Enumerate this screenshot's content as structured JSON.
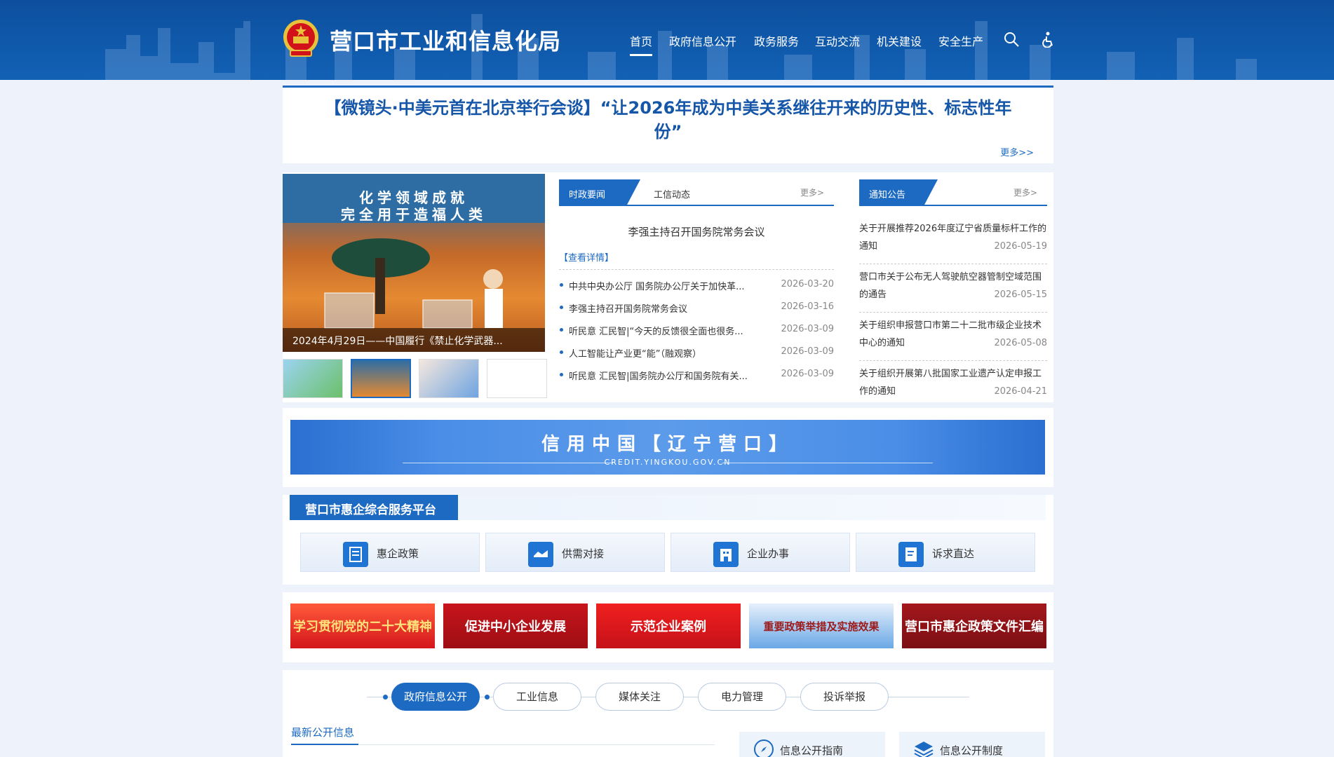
{
  "header": {
    "title": "营口市工业和信息化局",
    "nav": [
      {
        "label": "首页",
        "active": true
      },
      {
        "label": "政府信息公开"
      },
      {
        "label": "政务服务"
      },
      {
        "label": "互动交流"
      },
      {
        "label": "机关建设"
      },
      {
        "label": "安全生产"
      }
    ],
    "icons": [
      "search-icon",
      "accessibility-icon"
    ]
  },
  "headline": {
    "text": "【微镜头·中美元首在北京举行会谈】“让2026年成为中美关系继往开来的历史性、标志性年份”",
    "more": "更多>>"
  },
  "carousel": {
    "poster_line1": "化学领域成就",
    "poster_line2": "完全用于造福人类",
    "caption": "2024年4月29日——中国履行《禁止化学武器...",
    "thumbs": [
      "thumb-1",
      "thumb-2",
      "thumb-3",
      "thumb-4"
    ],
    "active_thumb": 1
  },
  "news": {
    "tab_active": "时政要闻",
    "tab_other": "工信动态",
    "more": "更多>",
    "feature_title": "李强主持召开国务院常务会议",
    "feature_link": "【查看详情】",
    "items": [
      {
        "title": "中共中央办公厅 国务院办公厅关于加快革...",
        "date": "2026-03-20"
      },
      {
        "title": "李强主持召开国务院常务会议",
        "date": "2026-03-16"
      },
      {
        "title": "听民意 汇民智|“今天的反馈很全面也很务...",
        "date": "2026-03-09"
      },
      {
        "title": "人工智能让产业更“能”（融观察）",
        "date": "2026-03-09"
      },
      {
        "title": "听民意 汇民智|国务院办公厅和国务院有关...",
        "date": "2026-03-09"
      }
    ]
  },
  "notice": {
    "tab_active": "通知公告",
    "more": "更多>",
    "items": [
      {
        "title": "关于开展推荐2026年度辽宁省质量标杆工作的通知",
        "date": "2026-05-19"
      },
      {
        "title": "营口市关于公布无人驾驶航空器管制空域范围的通告",
        "date": "2026-05-15"
      },
      {
        "title": "关于组织申报营口市第二十二批市级企业技术中心的通知",
        "date": "2026-05-08"
      },
      {
        "title": "关于组织开展第八批国家工业遗产认定申报工作的通知",
        "date": "2026-04-21"
      }
    ]
  },
  "credit": {
    "title": "信用中国【辽宁营口】",
    "subtitle": "CREDIT.YINGKOU.GOV.CN"
  },
  "platform": {
    "title": "营口市惠企综合服务平台",
    "services": [
      {
        "label": "惠企政策",
        "icon": "policy-doc-icon"
      },
      {
        "label": "供需对接",
        "icon": "handshake-icon"
      },
      {
        "label": "企业办事",
        "icon": "building-icon"
      },
      {
        "label": "诉求直达",
        "icon": "edit-note-icon"
      }
    ]
  },
  "promos": [
    {
      "label": "学习贯彻党的二十大精神"
    },
    {
      "label": "促进中小企业发展"
    },
    {
      "label": "示范企业案例"
    },
    {
      "label": "重要政策举措及实施效果"
    },
    {
      "label": "营口市惠企政策文件汇编"
    }
  ],
  "info_tabs": {
    "pills": [
      {
        "label": "政府信息公开",
        "active": true
      },
      {
        "label": "工业信息"
      },
      {
        "label": "媒体关注"
      },
      {
        "label": "电力管理"
      },
      {
        "label": "投诉举报"
      }
    ],
    "latest_title": "最新公开信息",
    "guides": [
      {
        "label": "信息公开指南",
        "icon": "compass-icon"
      },
      {
        "label": "信息公开制度",
        "icon": "layers-icon"
      }
    ]
  },
  "colors": {
    "brand": "#1d6ac2",
    "header": "#0d4f9e",
    "promo_red": "#c8141c"
  }
}
